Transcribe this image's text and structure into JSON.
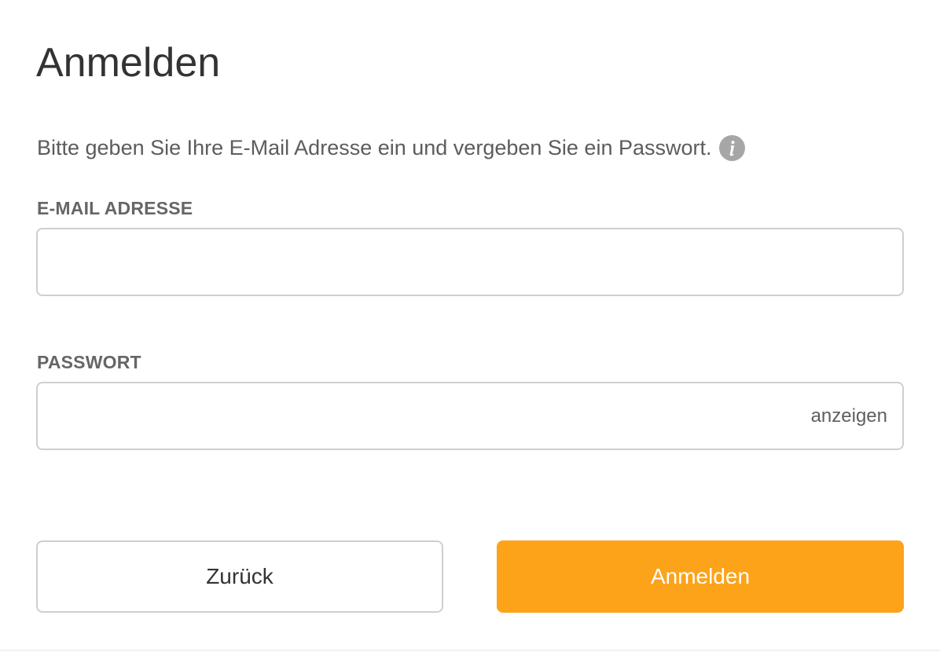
{
  "page": {
    "title": "Anmelden",
    "intro_text": "Bitte geben Sie Ihre E-Mail Adresse ein und vergeben Sie ein Passwort.",
    "info_icon": "info-icon"
  },
  "form": {
    "email": {
      "label": "E-MAIL ADRESSE",
      "value": "",
      "placeholder": ""
    },
    "password": {
      "label": "PASSWORT",
      "value": "",
      "placeholder": "",
      "toggle_label": "anzeigen"
    }
  },
  "actions": {
    "back_label": "Zurück",
    "submit_label": "Anmelden"
  },
  "colors": {
    "accent": "#fca31a",
    "border": "#cfcfcf",
    "info_icon_bg": "#a6a6a6"
  }
}
